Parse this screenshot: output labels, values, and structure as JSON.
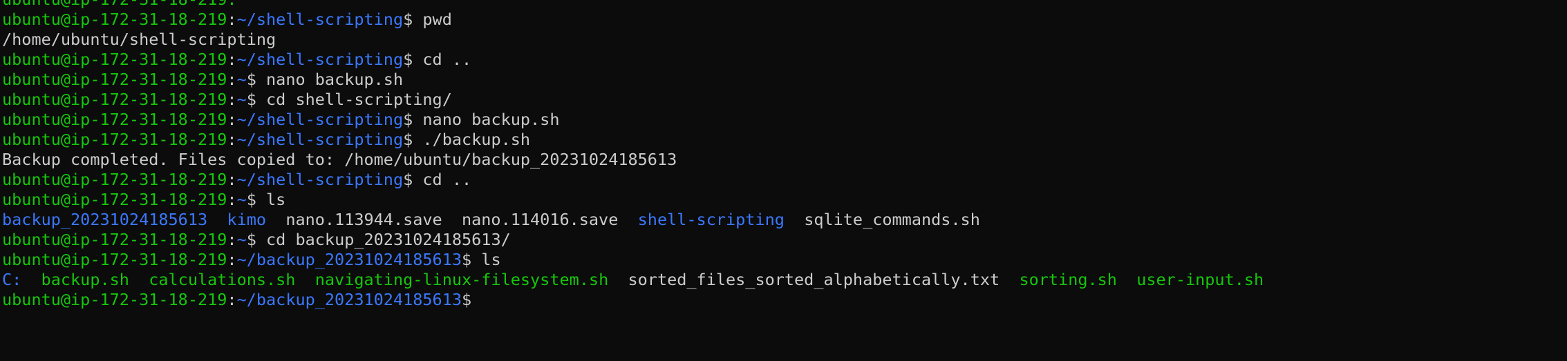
{
  "terminal": {
    "lines": [
      {
        "kind": "partial",
        "segments": [
          {
            "text": "ubuntu@ip-172-31-18-219:",
            "color": "green"
          }
        ]
      },
      {
        "kind": "prompt",
        "user": "ubuntu@ip-172-31-18-219",
        "path": "~/shell-scripting",
        "command": "pwd"
      },
      {
        "kind": "output",
        "segments": [
          {
            "text": "/home/ubuntu/shell-scripting",
            "color": "white"
          }
        ]
      },
      {
        "kind": "prompt",
        "user": "ubuntu@ip-172-31-18-219",
        "path": "~/shell-scripting",
        "command": "cd .."
      },
      {
        "kind": "prompt",
        "user": "ubuntu@ip-172-31-18-219",
        "path": "~",
        "command": "nano backup.sh"
      },
      {
        "kind": "prompt",
        "user": "ubuntu@ip-172-31-18-219",
        "path": "~",
        "command": "cd shell-scripting/"
      },
      {
        "kind": "prompt",
        "user": "ubuntu@ip-172-31-18-219",
        "path": "~/shell-scripting",
        "command": "nano backup.sh"
      },
      {
        "kind": "prompt",
        "user": "ubuntu@ip-172-31-18-219",
        "path": "~/shell-scripting",
        "command": "./backup.sh"
      },
      {
        "kind": "output",
        "segments": [
          {
            "text": "Backup completed. Files copied to: /home/ubuntu/backup_20231024185613",
            "color": "white"
          }
        ]
      },
      {
        "kind": "prompt",
        "user": "ubuntu@ip-172-31-18-219",
        "path": "~/shell-scripting",
        "command": "cd .."
      },
      {
        "kind": "prompt",
        "user": "ubuntu@ip-172-31-18-219",
        "path": "~",
        "command": "ls"
      },
      {
        "kind": "listing",
        "segments": [
          {
            "text": "backup_20231024185613",
            "color": "blue"
          },
          {
            "text": "  ",
            "color": "white"
          },
          {
            "text": "kimo",
            "color": "blue"
          },
          {
            "text": "  ",
            "color": "white"
          },
          {
            "text": "nano.113944.save",
            "color": "white"
          },
          {
            "text": "  ",
            "color": "white"
          },
          {
            "text": "nano.114016.save",
            "color": "white"
          },
          {
            "text": "  ",
            "color": "white"
          },
          {
            "text": "shell-scripting",
            "color": "blue"
          },
          {
            "text": "  ",
            "color": "white"
          },
          {
            "text": "sqlite_commands.sh",
            "color": "white"
          }
        ]
      },
      {
        "kind": "prompt",
        "user": "ubuntu@ip-172-31-18-219",
        "path": "~",
        "command": "cd backup_20231024185613/"
      },
      {
        "kind": "prompt",
        "user": "ubuntu@ip-172-31-18-219",
        "path": "~/backup_20231024185613",
        "command": "ls"
      },
      {
        "kind": "listing",
        "segments": [
          {
            "text": "C:",
            "color": "blue"
          },
          {
            "text": "  ",
            "color": "white"
          },
          {
            "text": "backup.sh",
            "color": "green"
          },
          {
            "text": "  ",
            "color": "white"
          },
          {
            "text": "calculations.sh",
            "color": "green"
          },
          {
            "text": "  ",
            "color": "white"
          },
          {
            "text": "navigating-linux-filesystem.sh",
            "color": "green"
          },
          {
            "text": "  ",
            "color": "white"
          },
          {
            "text": "sorted_files_sorted_alphabetically.txt",
            "color": "white"
          },
          {
            "text": "  ",
            "color": "white"
          },
          {
            "text": "sorting.sh",
            "color": "green"
          },
          {
            "text": "  ",
            "color": "white"
          },
          {
            "text": "user-input.sh",
            "color": "green"
          }
        ]
      },
      {
        "kind": "prompt",
        "user": "ubuntu@ip-172-31-18-219",
        "path": "~/backup_20231024185613",
        "command": ""
      }
    ]
  },
  "colors": {
    "background": "#0c0c0c",
    "foreground": "#cccccc",
    "green": "#16c60c",
    "blue": "#3b78ff"
  }
}
